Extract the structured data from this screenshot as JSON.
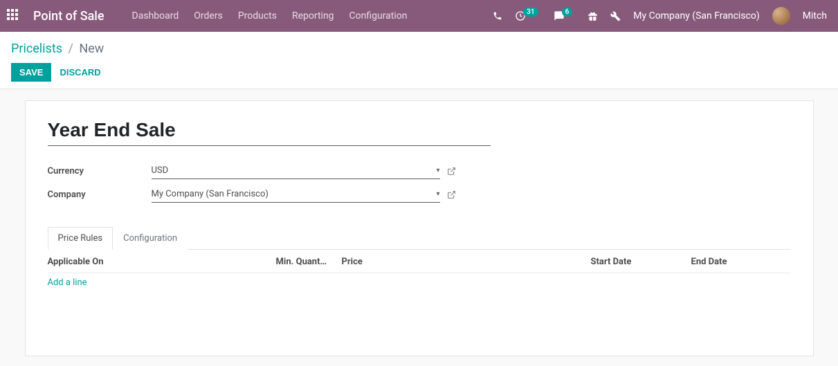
{
  "navbar": {
    "brand": "Point of Sale",
    "menu": [
      "Dashboard",
      "Orders",
      "Products",
      "Reporting",
      "Configuration"
    ],
    "activities_count": "31",
    "messages_count": "6",
    "company": "My Company (San Francisco)",
    "user_name": "Mitch"
  },
  "breadcrumb": {
    "parent": "Pricelists",
    "current": "New"
  },
  "buttons": {
    "save": "Save",
    "discard": "Discard"
  },
  "form": {
    "title": "Year End Sale",
    "fields": {
      "currency_label": "Currency",
      "currency_value": "USD",
      "company_label": "Company",
      "company_value": "My Company (San Francisco)"
    }
  },
  "tabs": {
    "price_rules": "Price Rules",
    "configuration": "Configuration"
  },
  "table": {
    "headers": {
      "applicable_on": "Applicable On",
      "min_qty": "Min. Quant…",
      "price": "Price",
      "start_date": "Start Date",
      "end_date": "End Date"
    },
    "add_line": "Add a line"
  }
}
